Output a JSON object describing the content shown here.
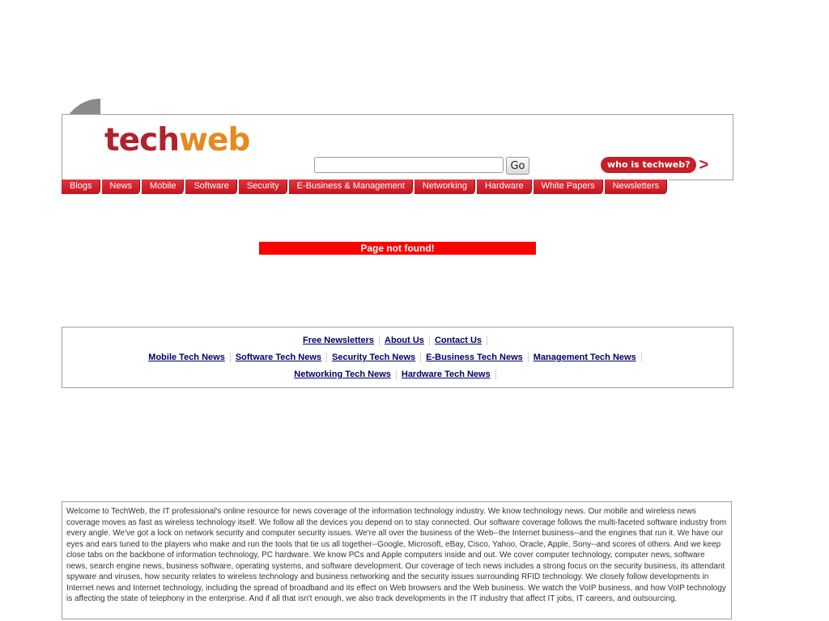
{
  "header": {
    "logo_tech": "tech",
    "logo_web": "web",
    "search": {
      "value": "",
      "placeholder": ""
    },
    "go_label": "Go",
    "who_label": "who is techweb?",
    "who_arrow": ">"
  },
  "nav": {
    "items": [
      {
        "label": "Blogs"
      },
      {
        "label": "News"
      },
      {
        "label": "Mobile"
      },
      {
        "label": "Software"
      },
      {
        "label": "Security"
      },
      {
        "label": "E-Business & Management"
      },
      {
        "label": "Networking"
      },
      {
        "label": "Hardware"
      },
      {
        "label": "White Papers"
      },
      {
        "label": "Newsletters"
      }
    ]
  },
  "error": {
    "message": "Page not found!"
  },
  "footer_links": {
    "row1": [
      "Free Newsletters",
      "About Us",
      "Contact Us"
    ],
    "row2": [
      "Mobile Tech News",
      "Software Tech News",
      "Security Tech News",
      "E-Business Tech News",
      "Management Tech News"
    ],
    "row3": [
      "Networking Tech News",
      "Hardware Tech News"
    ]
  },
  "about": {
    "text": "Welcome to TechWeb, the IT professional's online resource for news coverage of the information technology industry. We know technology news. Our mobile and wireless news coverage moves as fast as wireless technology itself. We follow all the devices you depend on to stay connected. Our software coverage follows the multi-faceted software industry from every angle. We've got a lock on network security and computer security issues. We're all over the business of the Web--the Internet business--and the engines that run it. We have our eyes and ears tuned to the players who make and run the tools that tie us all together--Google, Microsoft, eBay, Cisco, Yahoo, Oracle, Apple, Sony--and scores of others. And we keep close tabs on the backbone of information technology, PC hardware. We know PCs and Apple computers inside and out. We cover computer technology, computer news, software news, search engine news, business software, operating systems, and software development. Our coverage of tech news includes a strong focus on the security business, its attendant spyware and viruses, how security relates to wireless technology and business networking and the security issues surrounding RFID technology. We closely follow developments in Internet news and Internet technology, including the spread of broadband and its effect on Web browsers and the Web business. We watch the VoIP business, and how VoIP technology is affecting the state of telephony in the enterprise. And if all that isn't enough, we also track developments in the IT industry that affect IT jobs, IT careers, and outsourcing."
  },
  "colors": {
    "brand_red": "#b0222e",
    "brand_orange": "#e38a21",
    "nav_red": "#d4232b",
    "error_red": "#ff0000",
    "link_navy": "#000066"
  }
}
